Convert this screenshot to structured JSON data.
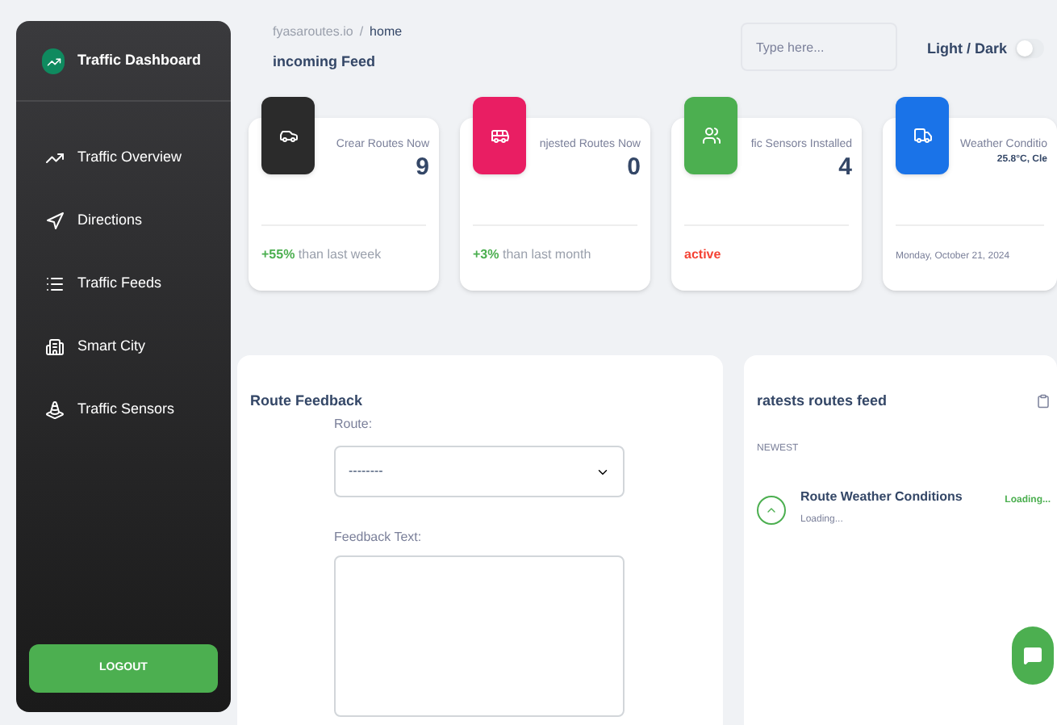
{
  "sidebar": {
    "brand": "Traffic Dashboard",
    "items": [
      {
        "label": "Traffic Overview",
        "selected": false
      },
      {
        "label": "Directions",
        "selected": false
      },
      {
        "label": "Traffic Feeds",
        "selected": false
      },
      {
        "label": "Smart City",
        "selected": false
      },
      {
        "label": "Traffic Sensors",
        "selected": false
      }
    ],
    "logout": "LOGOUT"
  },
  "header": {
    "breadcrumb": [
      "fyasaroutes.io",
      "home"
    ],
    "breadcrumb_separator": "/",
    "page_title": "incoming Feed",
    "search": {
      "placeholder": "Type here..."
    },
    "theme_toggle": {
      "label": "Light / Dark",
      "on": false
    }
  },
  "stat_cards": [
    {
      "color": "#2b2b2b",
      "title": "Crear Routes Now",
      "value": "9",
      "footer_accent": "+55%",
      "footer": "than last week",
      "kind": "change"
    },
    {
      "color": "#e91e63",
      "title": "njested Routes Now",
      "value": "0",
      "footer_accent": "+3%",
      "footer": "than last month",
      "kind": "change"
    },
    {
      "color": "#4caf50",
      "title": "fic Sensors Installed",
      "value": "4",
      "footer": "active",
      "kind": "status"
    },
    {
      "color": "#1a73e8",
      "title": "Weather Conditio",
      "value": "25.8°C, Cle",
      "footer": "Monday, October 21, 2024",
      "kind": "date"
    }
  ],
  "route_feedback": {
    "title": "Route Feedback",
    "route_label": "Route:",
    "route_value": "--------",
    "feedback_label": "Feedback Text:"
  },
  "feed": {
    "title": "ratests routes feed",
    "section": "NEWEST",
    "items": [
      {
        "title": "Route Weather Conditions",
        "subtitle": "Loading...",
        "status": "Loading..."
      }
    ]
  }
}
